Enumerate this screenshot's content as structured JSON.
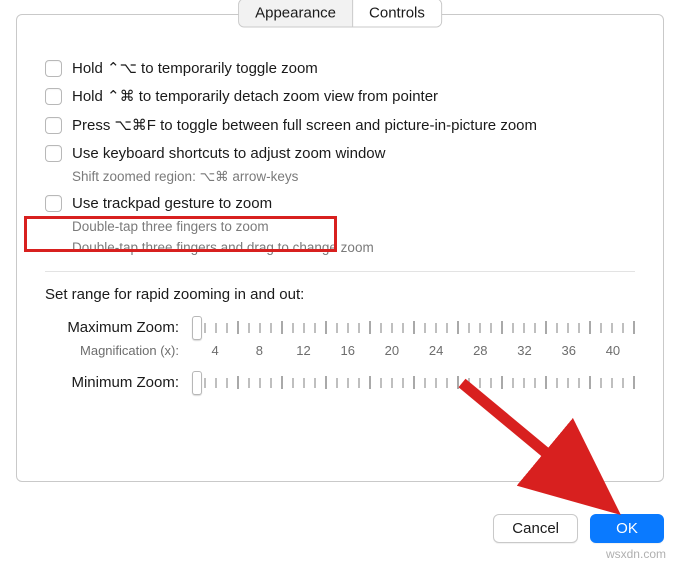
{
  "tabs": {
    "appearance": "Appearance",
    "controls": "Controls"
  },
  "options": {
    "hold_toggle": "Hold ⌃⌥ to temporarily toggle zoom",
    "hold_detach": "Hold ⌃⌘ to temporarily detach zoom view from pointer",
    "press_pip": "Press ⌥⌘F to toggle between full screen and picture-in-picture zoom",
    "keyboard_shortcuts": "Use keyboard shortcuts to adjust zoom window",
    "shift_region": "Shift zoomed region:   ⌥⌘ arrow-keys",
    "trackpad_gesture": "Use trackpad gesture to zoom",
    "trackpad_sub1": "Double-tap three fingers to zoom",
    "trackpad_sub2": "Double-tap three fingers and drag to change zoom"
  },
  "range": {
    "section": "Set range for rapid zooming in and out:",
    "max_label": "Maximum Zoom:",
    "min_label": "Minimum Zoom:",
    "mag_label": "Magnification (x):",
    "mag_values": [
      "4",
      "8",
      "12",
      "16",
      "20",
      "24",
      "28",
      "32",
      "36",
      "40"
    ]
  },
  "buttons": {
    "cancel": "Cancel",
    "ok": "OK"
  },
  "watermark": "wsxdn.com",
  "colors": {
    "highlight": "#d8201f",
    "primary": "#0a7aff"
  }
}
